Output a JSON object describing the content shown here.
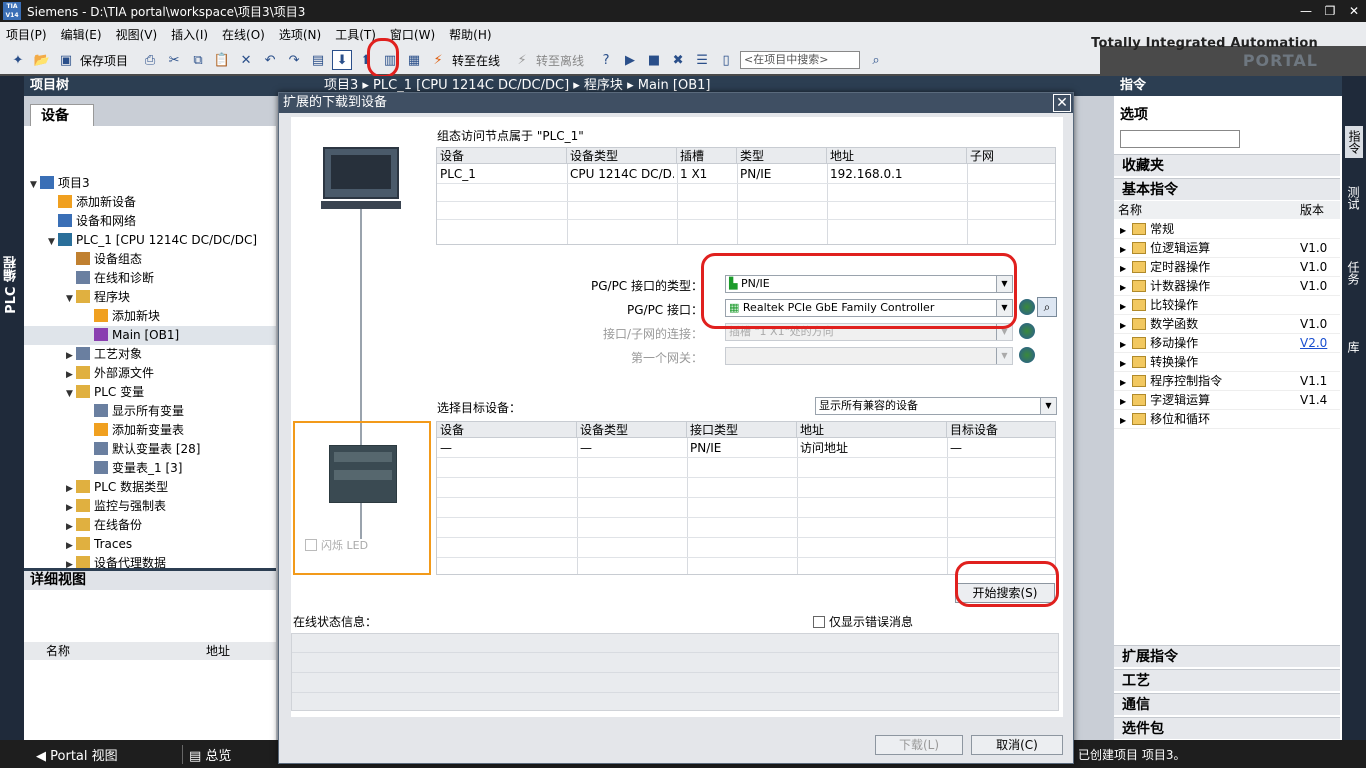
{
  "app": {
    "title": "Siemens  -  D:\\TIA portal\\workspace\\项目3\\项目3",
    "logo_text": "TIA V14"
  },
  "menu": [
    "项目(P)",
    "编辑(E)",
    "视图(V)",
    "插入(I)",
    "在线(O)",
    "选项(N)",
    "工具(T)",
    "窗口(W)",
    "帮助(H)"
  ],
  "toolbar": {
    "save_label": "保存项目",
    "go_online": "转至在线",
    "go_offline": "转至离线",
    "search_placeholder": "<在项目中搜索>"
  },
  "brand": {
    "line1": "Totally Integrated Automation",
    "line2": "PORTAL"
  },
  "left_strip": {
    "label": "PLC 编程"
  },
  "project_tree": {
    "header": "项目树",
    "tab": "设备",
    "items": [
      {
        "label": "项目3",
        "level": 0,
        "arrow": "▼"
      },
      {
        "label": "添加新设备",
        "level": 1,
        "arrow": ""
      },
      {
        "label": "设备和网络",
        "level": 1,
        "arrow": ""
      },
      {
        "label": "PLC_1 [CPU 1214C DC/DC/DC]",
        "level": 1,
        "arrow": "▼"
      },
      {
        "label": "设备组态",
        "level": 2,
        "arrow": ""
      },
      {
        "label": "在线和诊断",
        "level": 2,
        "arrow": ""
      },
      {
        "label": "程序块",
        "level": 2,
        "arrow": "▼"
      },
      {
        "label": "添加新块",
        "level": 3,
        "arrow": ""
      },
      {
        "label": "Main [OB1]",
        "level": 3,
        "arrow": ""
      },
      {
        "label": "工艺对象",
        "level": 2,
        "arrow": "▶"
      },
      {
        "label": "外部源文件",
        "level": 2,
        "arrow": "▶"
      },
      {
        "label": "PLC 变量",
        "level": 2,
        "arrow": "▼"
      },
      {
        "label": "显示所有变量",
        "level": 3,
        "arrow": ""
      },
      {
        "label": "添加新变量表",
        "level": 3,
        "arrow": ""
      },
      {
        "label": "默认变量表 [28]",
        "level": 3,
        "arrow": ""
      },
      {
        "label": "变量表_1 [3]",
        "level": 3,
        "arrow": ""
      },
      {
        "label": "PLC 数据类型",
        "level": 2,
        "arrow": "▶"
      },
      {
        "label": "监控与强制表",
        "level": 2,
        "arrow": "▶"
      },
      {
        "label": "在线备份",
        "level": 2,
        "arrow": "▶"
      },
      {
        "label": "Traces",
        "level": 2,
        "arrow": "▶"
      },
      {
        "label": "设备代理数据",
        "level": 2,
        "arrow": "▶"
      }
    ],
    "detail_header": "详细视图",
    "detail_cols": [
      "名称",
      "地址"
    ]
  },
  "editor": {
    "breadcrumb": "项目3  ▸  PLC_1 [CPU 1214C DC/DC/DC]  ▸  程序块  ▸  Main [OB1]"
  },
  "status_bar": {
    "portal_view": "Portal 视图",
    "overview": "总览",
    "message": "已创建项目 项目3。"
  },
  "right_panel": {
    "header": "指令",
    "options_label": "选项",
    "favorites": "收藏夹",
    "basic": "基本指令",
    "cols": [
      "名称",
      "版本"
    ],
    "instructions": [
      {
        "name": "常规",
        "ver": ""
      },
      {
        "name": "位逻辑运算",
        "ver": "V1.0"
      },
      {
        "name": "定时器操作",
        "ver": "V1.0"
      },
      {
        "name": "计数器操作",
        "ver": "V1.0"
      },
      {
        "name": "比较操作",
        "ver": ""
      },
      {
        "name": "数学函数",
        "ver": "V1.0"
      },
      {
        "name": "移动操作",
        "ver": "V2.0"
      },
      {
        "name": "转换操作",
        "ver": ""
      },
      {
        "name": "程序控制指令",
        "ver": "V1.1"
      },
      {
        "name": "字逻辑运算",
        "ver": "V1.4"
      },
      {
        "name": "移位和循环",
        "ver": ""
      }
    ],
    "ext": "扩展指令",
    "tech": "工艺",
    "comm": "通信",
    "opt": "选件包"
  },
  "right_strip": [
    "指令",
    "测试",
    "任务",
    "库"
  ],
  "dialog": {
    "title": "扩展的下载到设备",
    "config_caption": "组态访问节点属于 \"PLC_1\"",
    "config_cols": [
      "设备",
      "设备类型",
      "插槽",
      "类型",
      "地址",
      "子网"
    ],
    "config_row": [
      "PLC_1",
      "CPU 1214C DC/D...",
      "1 X1",
      "PN/IE",
      "192.168.0.1",
      ""
    ],
    "if_type_label": "PG/PC 接口的类型：",
    "if_type_value": "PN/IE",
    "if_label": "PG/PC 接口：",
    "if_value": "Realtek PCIe GbE Family Controller",
    "subnet_label": "接口/子网的连接：",
    "subnet_value": "插槽 \"1 X1\"处的方向",
    "gateway_label": "第一个网关：",
    "select_target_label": "选择目标设备：",
    "filter_value": "显示所有兼容的设备",
    "target_cols": [
      "设备",
      "设备类型",
      "接口类型",
      "地址",
      "目标设备"
    ],
    "target_row": [
      "—",
      "—",
      "PN/IE",
      "访问地址",
      "—"
    ],
    "flash_led": "闪烁 LED",
    "search_btn": "开始搜索(S)",
    "status_label": "在线状态信息：",
    "only_errors": "仅显示错误消息",
    "load_btn": "下载(L)",
    "cancel_btn": "取消(C)"
  }
}
